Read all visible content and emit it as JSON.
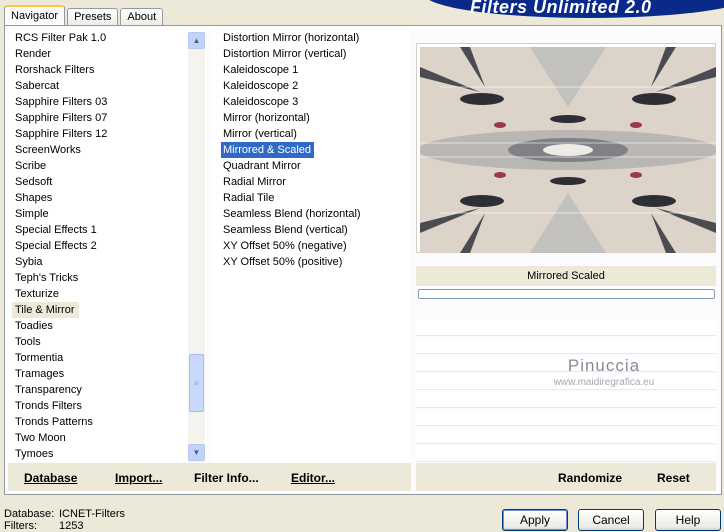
{
  "tabs": [
    "Navigator",
    "Presets",
    "About"
  ],
  "app_title": "Filters Unlimited 2.0",
  "categories": [
    "RCS Filter Pak 1.0",
    "Render",
    "Rorshack Filters",
    "Sabercat",
    "Sapphire Filters 03",
    "Sapphire Filters 07",
    "Sapphire Filters 12",
    "ScreenWorks",
    "Scribe",
    "Sedsoft",
    "Shapes",
    "Simple",
    "Special Effects 1",
    "Special Effects 2",
    "Sybia",
    "Teph's Tricks",
    "Texturize",
    "Tile & Mirror",
    "Toadies",
    "Tools",
    "Tormentia",
    "Tramages",
    "Transparency",
    "Tronds Filters",
    "Tronds Patterns",
    "Two Moon",
    "Tymoes"
  ],
  "selected_category": "Tile & Mirror",
  "filters": [
    "Distortion Mirror (horizontal)",
    "Distortion Mirror (vertical)",
    "Kaleidoscope 1",
    "Kaleidoscope 2",
    "Kaleidoscope 3",
    "Mirror (horizontal)",
    "Mirror (vertical)",
    "Mirrored & Scaled",
    "Quadrant Mirror",
    "Radial Mirror",
    "Radial Tile",
    "Seamless Blend (horizontal)",
    "Seamless Blend (vertical)",
    "XY Offset 50% (negative)",
    "XY Offset 50% (positive)"
  ],
  "selected_filter": "Mirrored & Scaled",
  "preview_filter_name": "Mirrored  Scaled",
  "watermark": {
    "title": "Pinuccia",
    "url": "www.maidiregrafica.eu"
  },
  "toolbar": {
    "database": "Database",
    "import": "Import...",
    "filter_info": "Filter Info...",
    "editor": "Editor...",
    "randomize": "Randomize",
    "reset": "Reset"
  },
  "status": {
    "database_label": "Database:",
    "database_value": "ICNET-Filters",
    "filters_label": "Filters:",
    "filters_value": "1253"
  },
  "buttons": {
    "apply": "Apply",
    "cancel": "Cancel",
    "help": "Help"
  },
  "colors": {
    "selection": "#316ac5",
    "title_banner": "#0a2a8a",
    "window_bg": "#ece9d8"
  },
  "icons": {
    "scroll_up": "chevron-up-icon",
    "scroll_down": "chevron-down-icon",
    "scroll_grip": "grip-icon"
  }
}
